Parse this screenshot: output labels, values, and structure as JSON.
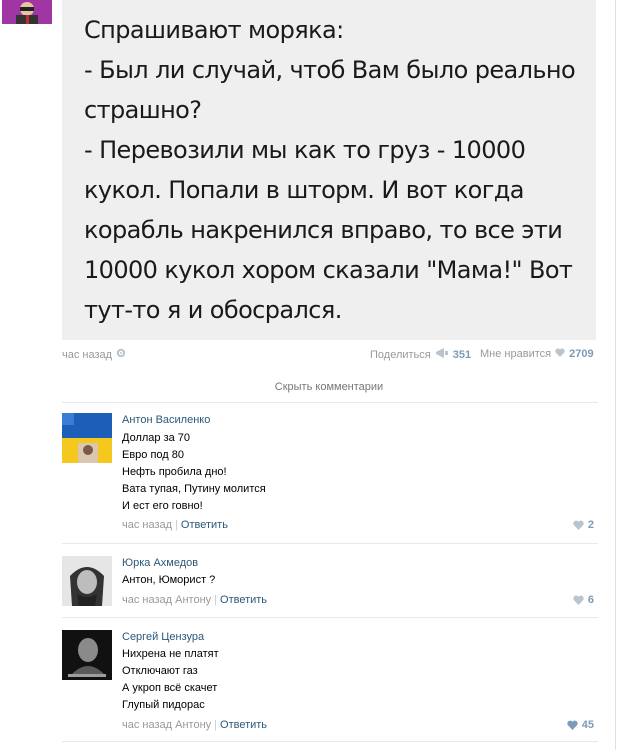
{
  "post": {
    "text_lines": [
      "Спрашивают моряка:",
      "- Был ли случай, чтоб Вам было реально",
      "страшно?",
      "- Перевозили мы как то груз - 10000",
      "кукол. Попали в шторм. И вот когда",
      "корабль накренился вправо, то все эти",
      "10000 кукол хором сказали \"Мама!\" Вот",
      "тут-то я и обосрался."
    ],
    "time": "час назад",
    "share_label": "Поделиться",
    "share_count": "351",
    "like_label": "Мне нравится",
    "like_count": "2709"
  },
  "comments_toggle": "Скрыть комментарии",
  "comments": [
    {
      "author": "Антон Василенко",
      "lines": [
        "Доллар за 70",
        "Евро под 80",
        "Нефть пробила дно!",
        "Вата тупая, Путину молится",
        "И ест его говно!"
      ],
      "time": "час назад",
      "reply_to": "",
      "reply_label": "Ответить",
      "likes": "2"
    },
    {
      "author": "Юрка Ахмедов",
      "lines": [
        "Антон, Юморист ?"
      ],
      "time": "час назад",
      "reply_to": "Антону",
      "reply_label": "Ответить",
      "likes": "6"
    },
    {
      "author": "Сергей Цензура",
      "lines": [
        "Нихрена не платят",
        "Отключают газ",
        "А укроп всё скачет",
        "Глупый пидорас"
      ],
      "time": "час назад",
      "reply_to": "Антону",
      "reply_label": "Ответить",
      "likes": "45"
    }
  ],
  "colors": {
    "link": "#2b587a",
    "meta": "#999999",
    "like": "#7d9bb8",
    "image_bg": "#efefef"
  },
  "icons": [
    "gear-icon",
    "megaphone-icon",
    "heart-icon"
  ]
}
